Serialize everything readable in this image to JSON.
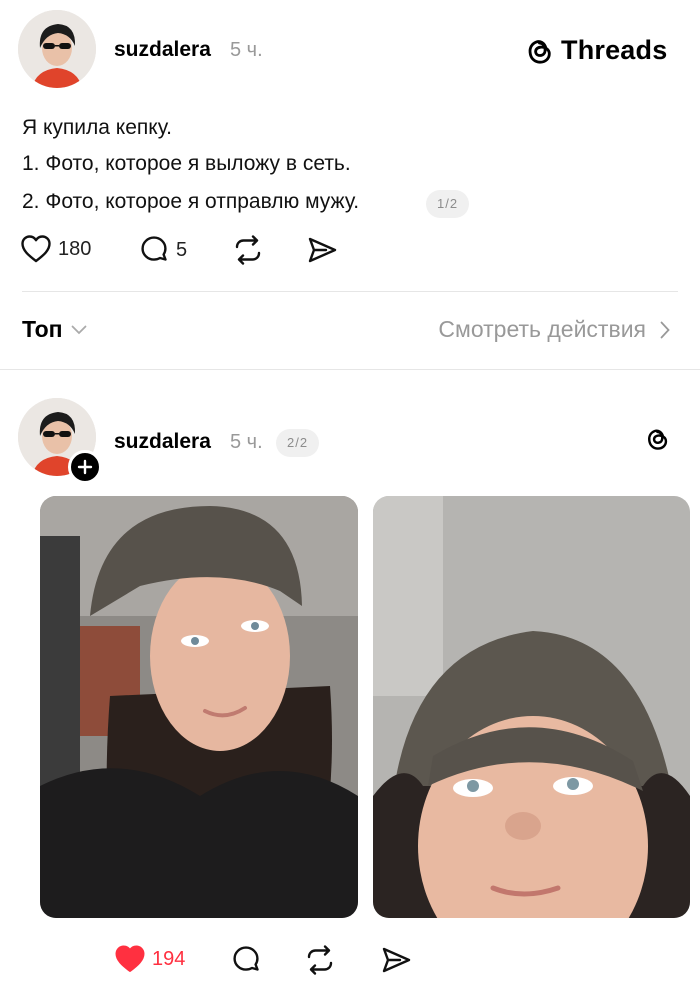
{
  "post1": {
    "username": "suzdalera",
    "time": "5 ч.",
    "brand": "Threads",
    "lines": [
      "Я купила кепку.",
      "1. Фото, которое я выложу в сеть.",
      "2. Фото, которое я отправлю мужу."
    ],
    "page_indicator": "1/2",
    "likes": "180",
    "replies": "5"
  },
  "sort": {
    "label": "Топ",
    "activity_link": "Смотреть действия"
  },
  "post2": {
    "username": "suzdalera",
    "time": "5 ч.",
    "page_indicator": "2/2",
    "likes": "194"
  },
  "colors": {
    "liked": "#ff3040",
    "muted": "#999999",
    "divider": "#e6e6e6"
  },
  "icons": [
    "heart-icon",
    "reply-icon",
    "repost-icon",
    "share-icon",
    "threads-logo-icon",
    "chevron-down-icon",
    "chevron-right-icon",
    "plus-icon"
  ]
}
